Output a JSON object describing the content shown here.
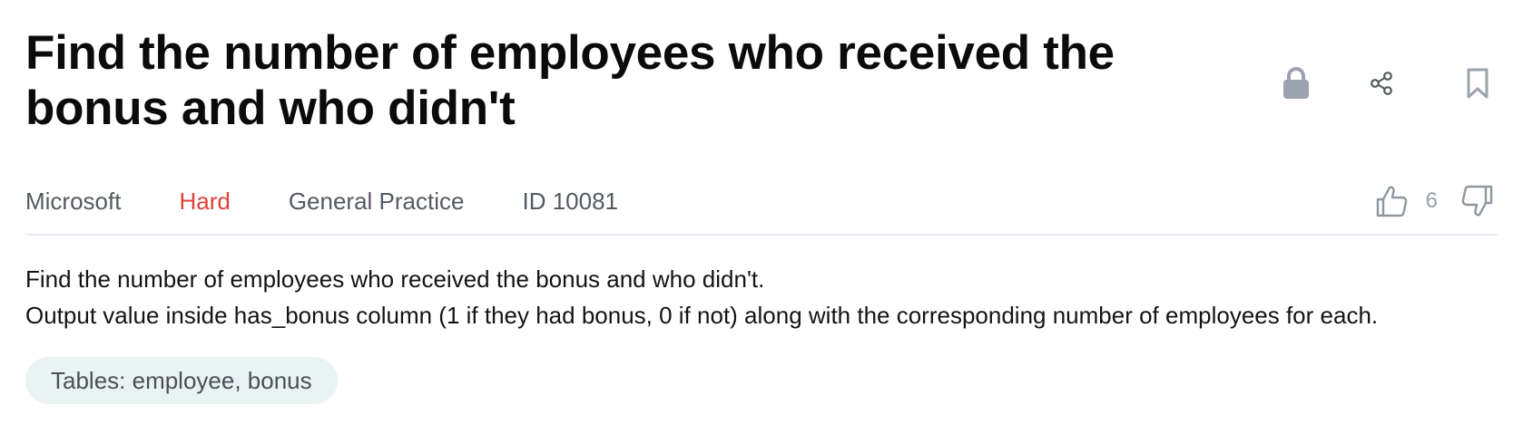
{
  "question": {
    "title": "Find the number of employees who received the bonus and who didn't",
    "meta": {
      "company": "Microsoft",
      "difficulty": "Hard",
      "category": "General Practice",
      "id": "ID 10081"
    },
    "votes": {
      "upvotes": "6"
    },
    "description": {
      "line1": "Find the number of employees who received the bonus and who didn't.",
      "line2": "Output value inside has_bonus column (1 if they had bonus, 0 if not) along with the corresponding number of employees for each."
    },
    "tables_label": "Tables: employee, bonus"
  },
  "icons": {
    "lock": "lock-icon",
    "share": "share-icon",
    "bookmark": "bookmark-icon",
    "thumbs_up": "thumbs-up-icon",
    "thumbs_down": "thumbs-down-icon"
  },
  "colors": {
    "difficulty_hard": "#e0413a",
    "icon_gray": "#9aa3ae",
    "chip_background": "#e9f3f2",
    "divider": "#e6ecf2"
  }
}
